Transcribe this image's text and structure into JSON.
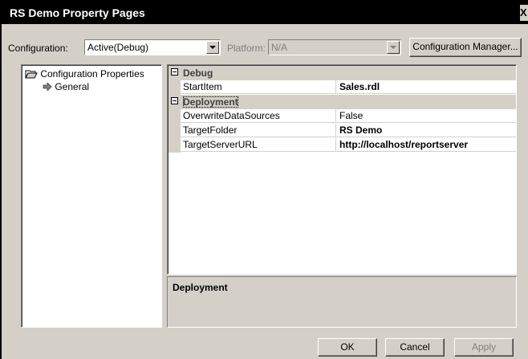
{
  "window": {
    "title": "RS Demo Property Pages",
    "close_glyph": "X"
  },
  "toolbar": {
    "configuration_label": "Configuration:",
    "configuration_value": "Active(Debug)",
    "platform_label": "Platform:",
    "platform_value": "N/A",
    "configuration_manager_label": "Configuration Manager..."
  },
  "tree": {
    "root_label": "Configuration Properties",
    "child_label": "General"
  },
  "grid": {
    "categories": [
      {
        "name": "Debug",
        "properties": [
          {
            "name": "StartItem",
            "value": "Sales.rdl",
            "bold": true
          }
        ]
      },
      {
        "name": "Deployment",
        "properties": [
          {
            "name": "OverwriteDataSources",
            "value": "False",
            "bold": false
          },
          {
            "name": "TargetFolder",
            "value": "RS Demo",
            "bold": true
          },
          {
            "name": "TargetServerURL",
            "value": "http://localhost/reportserver",
            "bold": true
          }
        ]
      }
    ]
  },
  "description": {
    "title": "Deployment"
  },
  "buttons": {
    "ok": "OK",
    "cancel": "Cancel",
    "apply": "Apply"
  },
  "colors": {
    "dialog_face": "#d4d0c8",
    "title_bar": "#000000"
  }
}
